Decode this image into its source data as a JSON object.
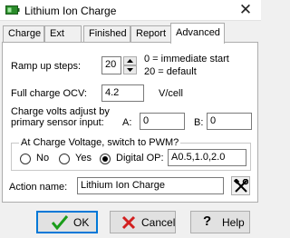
{
  "window": {
    "title": "Lithium Ion Charge"
  },
  "tabs": [
    "Charge",
    "Ext",
    "Finished",
    "Report",
    "Advanced"
  ],
  "advanced": {
    "ramp_label": "Ramp up steps:",
    "ramp_value": "20",
    "ramp_hint_1": "0 = immediate start",
    "ramp_hint_2": "20 = default",
    "ocv_label": "Full charge OCV:",
    "ocv_value": "4.2",
    "ocv_unit": "V/cell",
    "adjust_label_1": "Charge volts adjust by",
    "adjust_label_2": "primary sensor input:",
    "a_label": "A:",
    "a_value": "0",
    "b_label": "B:",
    "b_value": "0",
    "pwm_group_title": "At Charge Voltage, switch to PWM?",
    "radio_no": "No",
    "radio_yes": "Yes",
    "radio_digital": "Digital OP:",
    "selected_radio": "Digital OP:",
    "digital_op_value": "A0.5,1.0,2.0",
    "action_name_label": "Action name:",
    "action_name_value": "Lithium Ion Charge",
    "action_tool_icon": "hammer-wrench-icon"
  },
  "buttons": {
    "ok": "OK",
    "cancel": "Cancel",
    "help": "Help"
  },
  "colors": {
    "ok_check": "#1a9c1a",
    "cancel_x": "#d21f1f",
    "focus_border": "#0078d7"
  }
}
